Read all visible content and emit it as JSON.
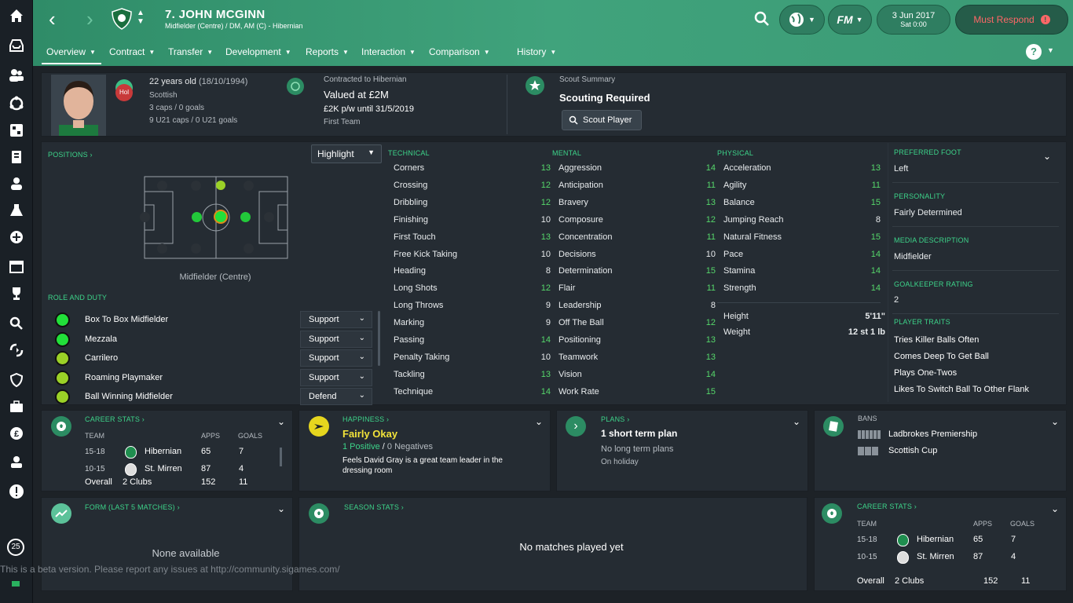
{
  "header": {
    "player_title": "7. JOHN MCGINN",
    "player_sub": "Midfielder (Centre) / DM, AM (C) - Hibernian",
    "date": "3 Jun 2017",
    "time": "Sat 0:00",
    "must_respond": "Must Respond",
    "fm_label": "FM"
  },
  "tabs": [
    {
      "label": "Overview"
    },
    {
      "label": "Contract"
    },
    {
      "label": "Transfer"
    },
    {
      "label": "Development"
    },
    {
      "label": "Reports"
    },
    {
      "label": "Interaction"
    },
    {
      "label": "Comparison"
    },
    {
      "label": "History"
    }
  ],
  "profile": {
    "age": "22 years old",
    "dob": "(18/10/1994)",
    "nationality": "Scottish",
    "caps": "3 caps / 0 goals",
    "u21_caps": "9 U21 caps / 0 U21 goals",
    "badge": "Hol",
    "contract_label": "Contracted to Hibernian",
    "value": "Valued at £2M",
    "wage": "£2K p/w until 31/5/2019",
    "squad": "First Team",
    "scout_label": "Scout Summary",
    "scout_status": "Scouting Required",
    "scout_button": "Scout Player"
  },
  "positions": {
    "label": "POSITIONS",
    "highlight": "Highlight",
    "position_name": "Midfielder (Centre)",
    "role_label": "ROLE AND DUTY",
    "roles": [
      {
        "name": "Box To Box Midfielder",
        "duty": "Support",
        "color": "#22e03a"
      },
      {
        "name": "Mezzala",
        "duty": "Support",
        "color": "#22e03a"
      },
      {
        "name": "Carrilero",
        "duty": "Support",
        "color": "#9bd127"
      },
      {
        "name": "Roaming Playmaker",
        "duty": "Support",
        "color": "#9bd127"
      },
      {
        "name": "Ball Winning Midfielder",
        "duty": "Defend",
        "color": "#9bd127"
      }
    ]
  },
  "technical": {
    "label": "TECHNICAL",
    "attrs": [
      {
        "n": "Corners",
        "v": "13"
      },
      {
        "n": "Crossing",
        "v": "12"
      },
      {
        "n": "Dribbling",
        "v": "12"
      },
      {
        "n": "Finishing",
        "v": "10"
      },
      {
        "n": "First Touch",
        "v": "13"
      },
      {
        "n": "Free Kick Taking",
        "v": "10"
      },
      {
        "n": "Heading",
        "v": "8"
      },
      {
        "n": "Long Shots",
        "v": "12"
      },
      {
        "n": "Long Throws",
        "v": "9"
      },
      {
        "n": "Marking",
        "v": "9"
      },
      {
        "n": "Passing",
        "v": "14"
      },
      {
        "n": "Penalty Taking",
        "v": "10"
      },
      {
        "n": "Tackling",
        "v": "13"
      },
      {
        "n": "Technique",
        "v": "14"
      }
    ]
  },
  "mental": {
    "label": "MENTAL",
    "attrs": [
      {
        "n": "Aggression",
        "v": "14"
      },
      {
        "n": "Anticipation",
        "v": "11"
      },
      {
        "n": "Bravery",
        "v": "13"
      },
      {
        "n": "Composure",
        "v": "12"
      },
      {
        "n": "Concentration",
        "v": "11"
      },
      {
        "n": "Decisions",
        "v": "10"
      },
      {
        "n": "Determination",
        "v": "15"
      },
      {
        "n": "Flair",
        "v": "11"
      },
      {
        "n": "Leadership",
        "v": "8"
      },
      {
        "n": "Off The Ball",
        "v": "12"
      },
      {
        "n": "Positioning",
        "v": "13"
      },
      {
        "n": "Teamwork",
        "v": "13"
      },
      {
        "n": "Vision",
        "v": "14"
      },
      {
        "n": "Work Rate",
        "v": "15"
      }
    ]
  },
  "physical": {
    "label": "PHYSICAL",
    "attrs": [
      {
        "n": "Acceleration",
        "v": "13"
      },
      {
        "n": "Agility",
        "v": "11"
      },
      {
        "n": "Balance",
        "v": "15"
      },
      {
        "n": "Jumping Reach",
        "v": "8"
      },
      {
        "n": "Natural Fitness",
        "v": "15"
      },
      {
        "n": "Pace",
        "v": "14"
      },
      {
        "n": "Stamina",
        "v": "14"
      },
      {
        "n": "Strength",
        "v": "14"
      }
    ],
    "height_label": "Height",
    "height": "5'11\"",
    "weight_label": "Weight",
    "weight": "12 st 1 lb"
  },
  "info": {
    "foot_label": "PREFERRED FOOT",
    "foot": "Left",
    "personality_label": "PERSONALITY",
    "personality": "Fairly Determined",
    "media_label": "MEDIA DESCRIPTION",
    "media": "Midfielder",
    "gk_label": "GOALKEEPER RATING",
    "gk": "2",
    "traits_label": "PLAYER TRAITS",
    "traits": [
      "Tries Killer Balls Often",
      "Comes Deep To Get Ball",
      "Plays One-Twos",
      "Likes To Switch Ball To Other Flank"
    ]
  },
  "career1": {
    "label": "CAREER STATS",
    "cols": [
      "TEAM",
      "APPS",
      "GOALS"
    ],
    "rows": [
      {
        "years": "15-18",
        "club": "Hibernian",
        "apps": "65",
        "goals": "7"
      },
      {
        "years": "10-15",
        "club": "St. Mirren",
        "apps": "87",
        "goals": "4"
      }
    ],
    "overall": "Overall",
    "clubs": "2 Clubs",
    "total_apps": "152",
    "total_goals": "11"
  },
  "happiness": {
    "label": "HAPPINESS",
    "status": "Fairly Okay",
    "positive": "1 Positive",
    "sep": "/",
    "negatives": "0 Negatives",
    "note": "Feels David Gray is a great team leader in the dressing room"
  },
  "plans": {
    "label": "PLANS",
    "title": "1 short term plan",
    "line1": "No long term plans",
    "line2": "On holiday"
  },
  "bans": {
    "label": "BANS",
    "items": [
      "Ladbrokes Premiership",
      "Scottish Cup"
    ]
  },
  "form": {
    "label": "FORM (LAST 5 MATCHES)",
    "empty": "None available"
  },
  "season": {
    "label": "SEASON STATS",
    "empty": "No matches played yet"
  },
  "career2": {
    "label": "CAREER STATS",
    "cols": [
      "TEAM",
      "APPS",
      "GOALS"
    ],
    "rows": [
      {
        "years": "15-18",
        "club": "Hibernian",
        "apps": "65",
        "goals": "7"
      },
      {
        "years": "10-15",
        "club": "St. Mirren",
        "apps": "87",
        "goals": "4"
      }
    ],
    "overall": "Overall",
    "clubs": "2 Clubs",
    "total_apps": "152",
    "total_goals": "11"
  },
  "footer": {
    "beta": "This is a beta version. Please report any issues at http://community.sigames.com/",
    "inbox_count": "25"
  },
  "colors": {
    "accent": "#3dd48a",
    "topbar": "#3b9a75",
    "panel": "#252c33",
    "must_respond": "#e35a5a"
  }
}
